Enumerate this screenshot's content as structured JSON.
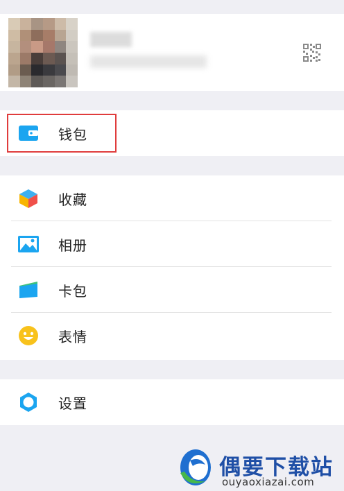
{
  "profile": {
    "avatar_pixels": [
      "#d9cbb6",
      "#c9b29c",
      "#a89484",
      "#b69a86",
      "#cdbba8",
      "#d8d2c8",
      "#cfbca4",
      "#b09078",
      "#8e6e5c",
      "#a77d68",
      "#b8a592",
      "#d2cdc4",
      "#c7b59f",
      "#b38f7d",
      "#c99a86",
      "#a6786a",
      "#8f8680",
      "#cbc6be",
      "#bba58e",
      "#9c7a68",
      "#4a3e3a",
      "#6c5a52",
      "#5b5350",
      "#c5c0b8",
      "#b19c86",
      "#6b5c50",
      "#2a2a2e",
      "#3a3a3e",
      "#4a4a4e",
      "#bfbab3",
      "#c3b6a6",
      "#8e8376",
      "#5e5a57",
      "#6a6663",
      "#7a7674",
      "#c9c5bf"
    ]
  },
  "icons": {
    "qr": "qr-code-icon",
    "wallet": "wallet-icon",
    "favorites": "cube-icon",
    "album": "picture-icon",
    "cards": "card-icon",
    "stickers": "smiley-icon",
    "settings": "gear-icon"
  },
  "menu": {
    "wallet": "钱包",
    "favorites": "收藏",
    "album": "相册",
    "cards": "卡包",
    "stickers": "表情",
    "settings": "设置"
  },
  "colors": {
    "accent": "#1ba5f0",
    "highlight": "#e03c3c",
    "background": "#efeff4"
  },
  "watermark": {
    "title": "偶要下载站",
    "url": "ouyaoxiazai.com"
  }
}
